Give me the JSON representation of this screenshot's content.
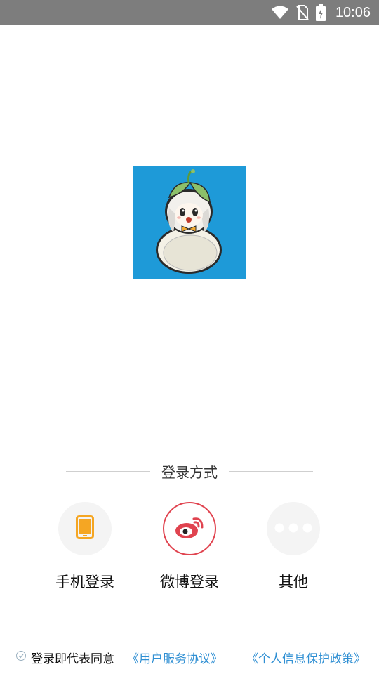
{
  "status_bar": {
    "time": "10:06",
    "icons": [
      "wifi-icon",
      "no-sim-icon",
      "battery-charging-icon"
    ]
  },
  "logo": {
    "icon": "gourd-mascot-logo",
    "background": "#1e9ad8"
  },
  "login": {
    "section_title": "登录方式",
    "options": [
      {
        "label": "手机登录",
        "icon": "phone-icon",
        "color": "#f5a623"
      },
      {
        "label": "微博登录",
        "icon": "weibo-icon",
        "color": "#e0434f"
      },
      {
        "label": "其他",
        "icon": "more-dots-icon"
      }
    ]
  },
  "agreement": {
    "text": "登录即代表同意",
    "user_agreement": "《用户服务协议》",
    "privacy_policy": "《个人信息保护政策》",
    "link_color": "#2f8fd3"
  }
}
